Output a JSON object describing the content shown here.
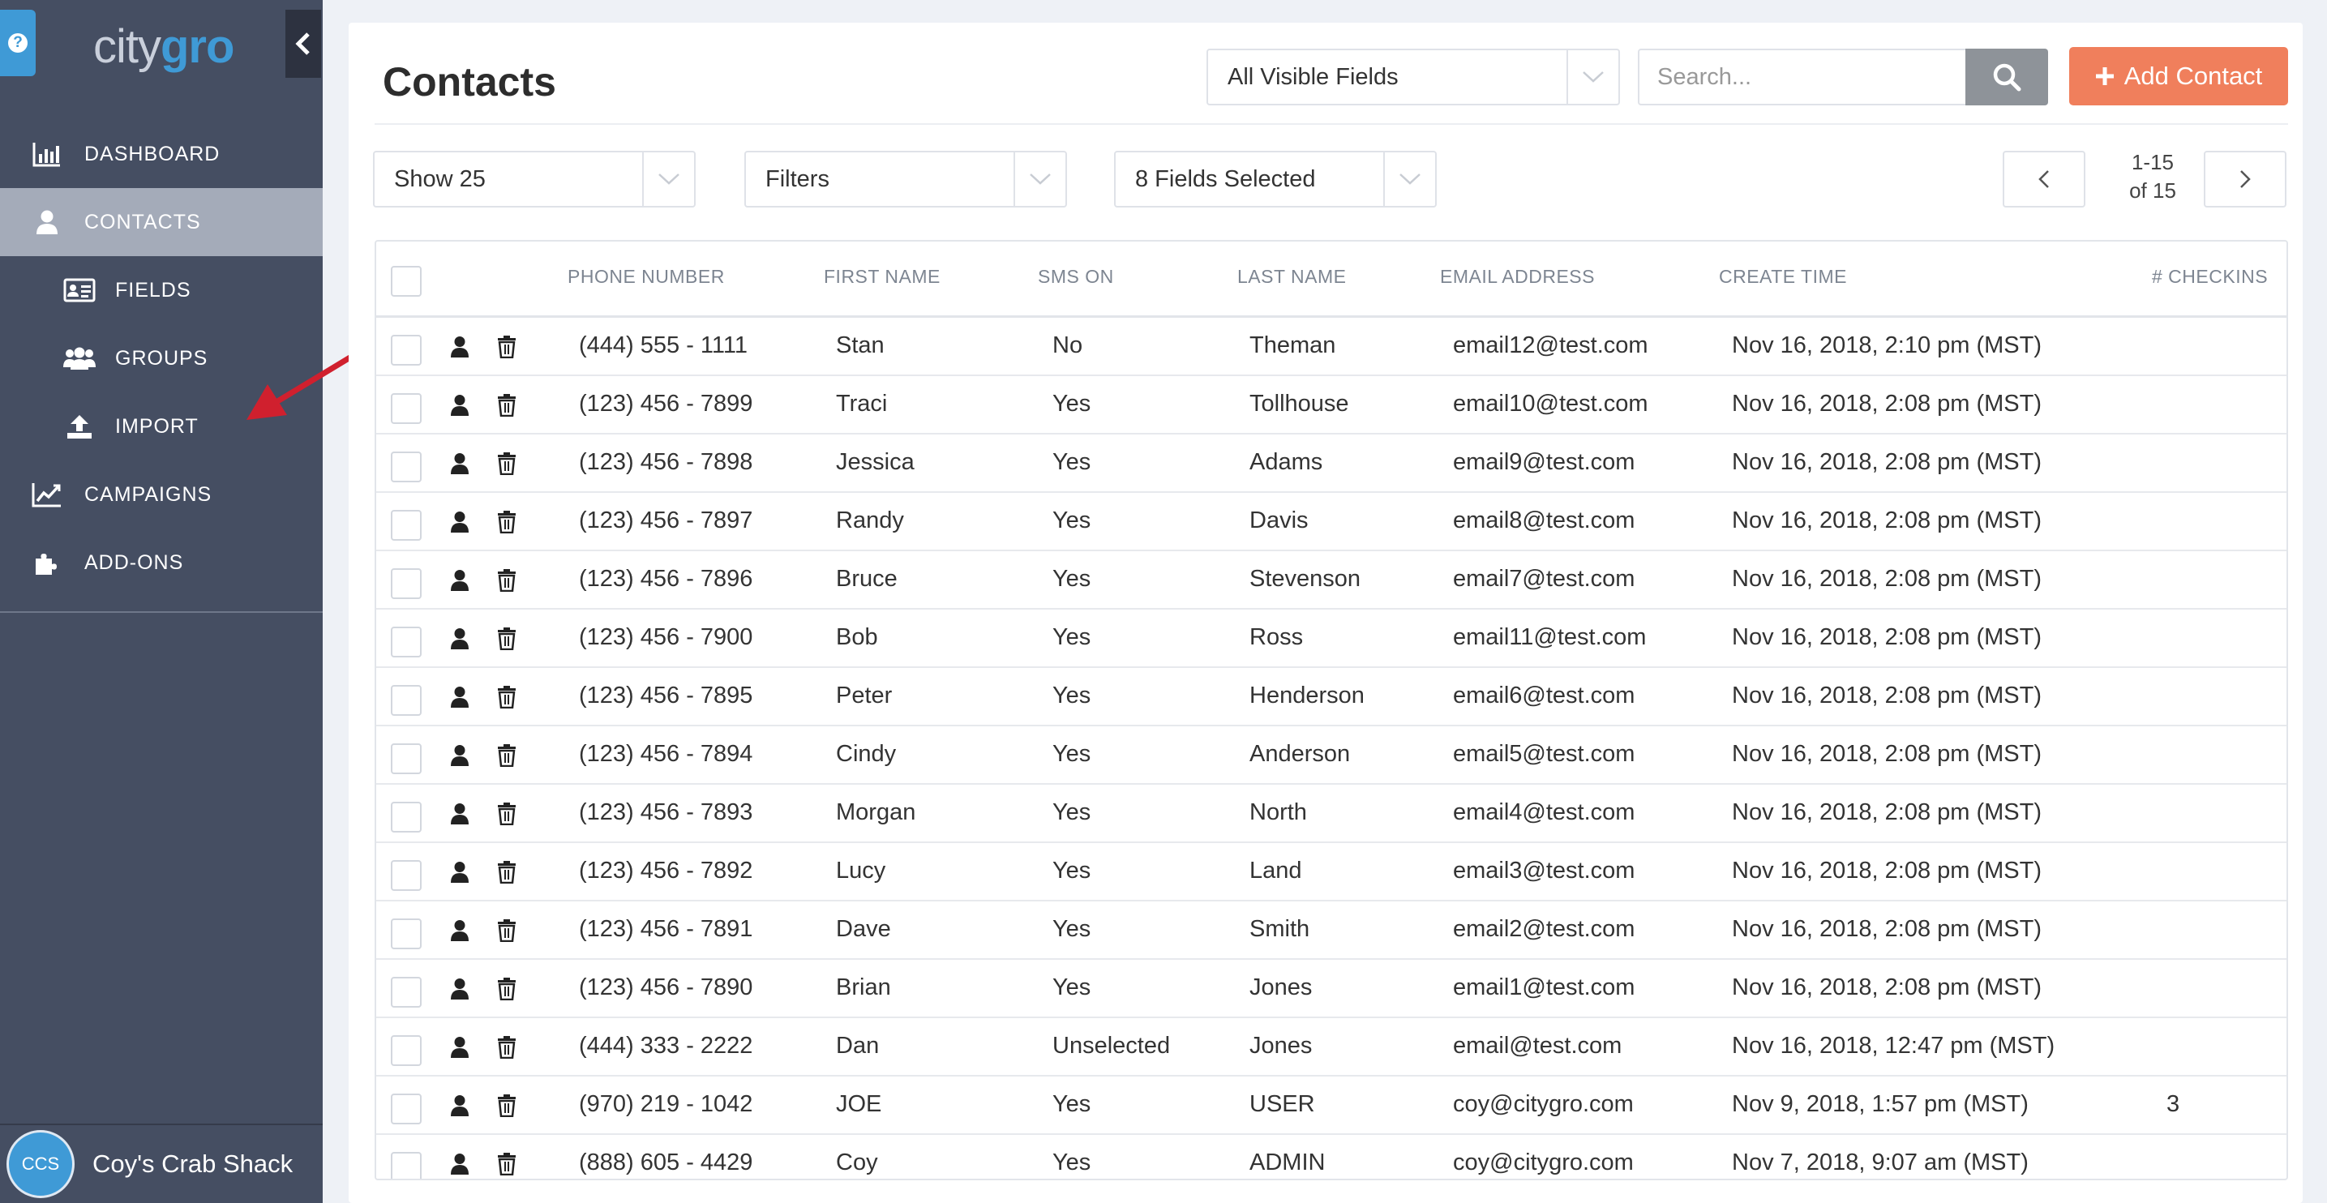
{
  "app": {
    "logo_part1": "city",
    "logo_part2": "gro",
    "help_label": "?"
  },
  "sidebar": {
    "items": [
      {
        "label": "DASHBOARD",
        "icon": "bar-chart-icon",
        "level": "top"
      },
      {
        "label": "CONTACTS",
        "icon": "user-icon",
        "level": "top",
        "active": true
      },
      {
        "label": "FIELDS",
        "icon": "id-card-icon",
        "level": "sub"
      },
      {
        "label": "GROUPS",
        "icon": "users-icon",
        "level": "sub"
      },
      {
        "label": "IMPORT",
        "icon": "upload-icon",
        "level": "sub"
      },
      {
        "label": "CAMPAIGNS",
        "icon": "line-chart-icon",
        "level": "top"
      },
      {
        "label": "ADD-ONS",
        "icon": "puzzle-icon",
        "level": "top"
      }
    ],
    "account": {
      "initials": "CCS",
      "name": "Coy's Crab Shack"
    }
  },
  "main": {
    "title": "Contacts",
    "field_filter": "All Visible Fields",
    "search_placeholder": "Search...",
    "add_button": "Add Contact",
    "show_select": "Show 25",
    "filters_select": "Filters",
    "fields_select": "8 Fields Selected",
    "pager": {
      "range": "1-15",
      "total": "of 15"
    }
  },
  "table": {
    "columns": [
      "PHONE NUMBER",
      "FIRST NAME",
      "SMS ON",
      "LAST NAME",
      "EMAIL ADDRESS",
      "CREATE TIME",
      "# CHECKINS"
    ],
    "rows": [
      [
        "(444) 555 - 1111",
        "Stan",
        "No",
        "Theman",
        "email12@test.com",
        "Nov 16, 2018, 2:10 pm (MST)",
        ""
      ],
      [
        "(123) 456 - 7899",
        "Traci",
        "Yes",
        "Tollhouse",
        "email10@test.com",
        "Nov 16, 2018, 2:08 pm (MST)",
        ""
      ],
      [
        "(123) 456 - 7898",
        "Jessica",
        "Yes",
        "Adams",
        "email9@test.com",
        "Nov 16, 2018, 2:08 pm (MST)",
        ""
      ],
      [
        "(123) 456 - 7897",
        "Randy",
        "Yes",
        "Davis",
        "email8@test.com",
        "Nov 16, 2018, 2:08 pm (MST)",
        ""
      ],
      [
        "(123) 456 - 7896",
        "Bruce",
        "Yes",
        "Stevenson",
        "email7@test.com",
        "Nov 16, 2018, 2:08 pm (MST)",
        ""
      ],
      [
        "(123) 456 - 7900",
        "Bob",
        "Yes",
        "Ross",
        "email11@test.com",
        "Nov 16, 2018, 2:08 pm (MST)",
        ""
      ],
      [
        "(123) 456 - 7895",
        "Peter",
        "Yes",
        "Henderson",
        "email6@test.com",
        "Nov 16, 2018, 2:08 pm (MST)",
        ""
      ],
      [
        "(123) 456 - 7894",
        "Cindy",
        "Yes",
        "Anderson",
        "email5@test.com",
        "Nov 16, 2018, 2:08 pm (MST)",
        ""
      ],
      [
        "(123) 456 - 7893",
        "Morgan",
        "Yes",
        "North",
        "email4@test.com",
        "Nov 16, 2018, 2:08 pm (MST)",
        ""
      ],
      [
        "(123) 456 - 7892",
        "Lucy",
        "Yes",
        "Land",
        "email3@test.com",
        "Nov 16, 2018, 2:08 pm (MST)",
        ""
      ],
      [
        "(123) 456 - 7891",
        "Dave",
        "Yes",
        "Smith",
        "email2@test.com",
        "Nov 16, 2018, 2:08 pm (MST)",
        ""
      ],
      [
        "(123) 456 - 7890",
        "Brian",
        "Yes",
        "Jones",
        "email1@test.com",
        "Nov 16, 2018, 2:08 pm (MST)",
        ""
      ],
      [
        "(444) 333 - 2222",
        "Dan",
        "Unselected",
        "Jones",
        "email@test.com",
        "Nov 16, 2018, 12:47 pm (MST)",
        ""
      ],
      [
        "(970) 219 - 1042",
        "JOE",
        "Yes",
        "USER",
        "coy@citygro.com",
        "Nov 9, 2018, 1:57 pm (MST)",
        "3"
      ],
      [
        "(888) 605 - 4429",
        "Coy",
        "Yes",
        "ADMIN",
        "coy@citygro.com",
        "Nov 7, 2018, 9:07 am (MST)",
        ""
      ]
    ]
  },
  "colors": {
    "sidebar_bg": "#454e62",
    "active_item": "#a4abb9",
    "accent_blue": "#3f9ad6",
    "add_button": "#f07f5c",
    "annotation_arrow": "#d0202e"
  }
}
